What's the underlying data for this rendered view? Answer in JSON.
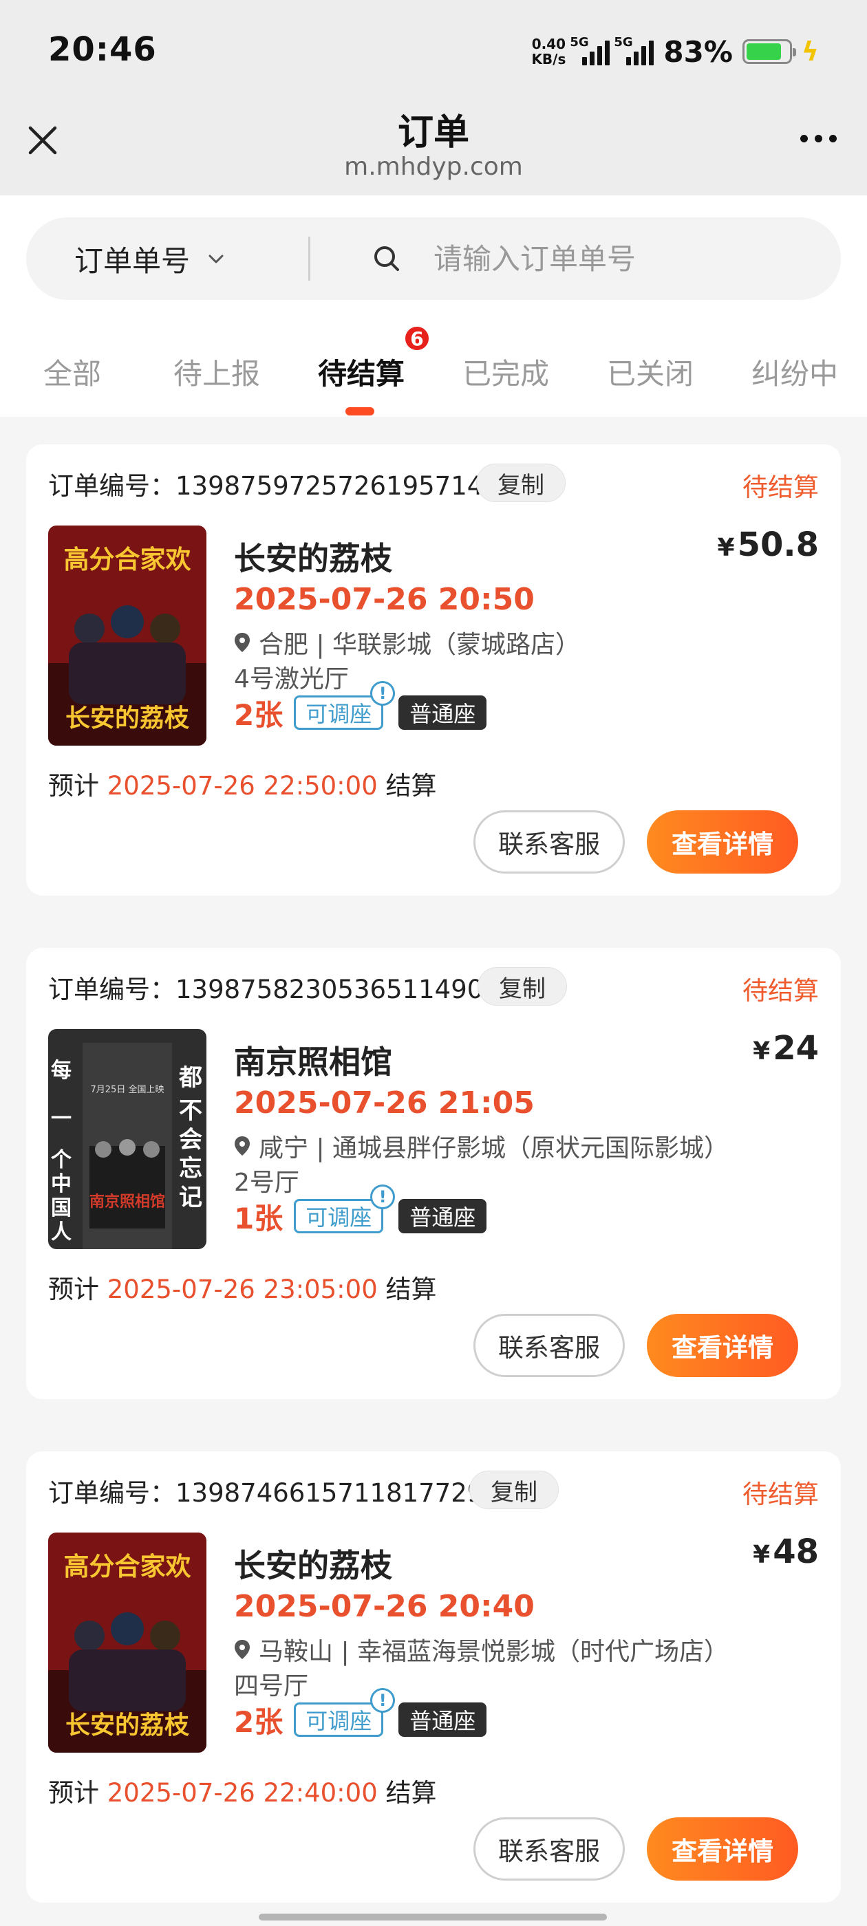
{
  "status_bar": {
    "time": "20:46",
    "net_speed_value": "0.40",
    "net_speed_unit": "KB/s",
    "signal1_label": "5G",
    "signal2_label": "5G",
    "battery_pct": "83%",
    "battery_level": 0.83,
    "battery_color": "#35d24a"
  },
  "header": {
    "title": "订单",
    "domain": "m.mhdyp.com",
    "close_icon": "close-icon",
    "more_icon": "more-dots-icon"
  },
  "search": {
    "type_label": "订单单号",
    "placeholder": "请输入订单单号"
  },
  "tabs": [
    {
      "label": "全部"
    },
    {
      "label": "待上报"
    },
    {
      "label": "待结算",
      "badge": "6",
      "active": true
    },
    {
      "label": "已完成"
    },
    {
      "label": "已关闭"
    },
    {
      "label": "纠纷中"
    }
  ],
  "orders": [
    {
      "order_no_label": "订单编号：",
      "order_no": "1398759725726195714",
      "copy_label": "复制",
      "status": "待结算",
      "title": "长安的荔枝",
      "price_symbol": "¥",
      "price": "50.8",
      "showtime": "2025-07-26 20:50",
      "cinema": "合肥 | 华联影城（蒙城路店）",
      "hall": "4号激光厅",
      "quantity": "2张",
      "adjust_tag": "可调座",
      "info_mark": "!",
      "seat_tag": "普通座",
      "settle_prefix": "预计 ",
      "settle_time": "2025-07-26 22:50:00",
      "settle_suffix": " 结算",
      "service_button": "联系客服",
      "detail_button": "查看详情",
      "poster_text_top": "高分合家欢",
      "poster_text_bottom": "长安的荔枝"
    },
    {
      "order_no_label": "订单编号：",
      "order_no": "1398758230536511490",
      "copy_label": "复制",
      "status": "待结算",
      "title": "南京照相馆",
      "price_symbol": "¥",
      "price": "24",
      "showtime": "2025-07-26 21:05",
      "cinema": "咸宁 | 通城县胖仔影城（原状元国际影城）",
      "hall": "2号厅",
      "quantity": "1张",
      "adjust_tag": "可调座",
      "info_mark": "!",
      "seat_tag": "普通座",
      "settle_prefix": "预计 ",
      "settle_time": "2025-07-26 23:05:00",
      "settle_suffix": " 结算",
      "service_button": "联系客服",
      "detail_button": "查看详情",
      "poster_text_left": "每一个中国人",
      "poster_text_right": "都不会忘记",
      "poster_text_bottom": "南京照相馆",
      "poster_date": "7月25日 全国上映"
    },
    {
      "order_no_label": "订单编号：",
      "order_no": "1398746615711817729",
      "copy_label": "复制",
      "status": "待结算",
      "title": "长安的荔枝",
      "price_symbol": "¥",
      "price": "48",
      "showtime": "2025-07-26 20:40",
      "cinema": "马鞍山 | 幸福蓝海景悦影城（时代广场店）",
      "hall": "四号厅",
      "quantity": "2张",
      "adjust_tag": "可调座",
      "info_mark": "!",
      "seat_tag": "普通座",
      "settle_prefix": "预计 ",
      "settle_time": "2025-07-26 22:40:00",
      "settle_suffix": " 结算",
      "service_button": "联系客服",
      "detail_button": "查看详情",
      "poster_text_top": "高分合家欢",
      "poster_text_bottom": "长安的荔枝"
    }
  ]
}
